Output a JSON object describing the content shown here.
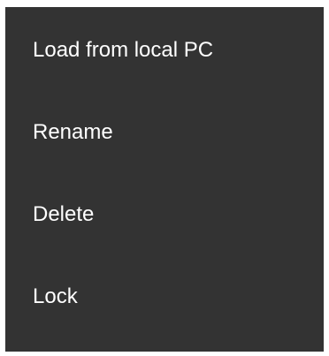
{
  "context_menu": {
    "items": [
      {
        "label": "Load from local PC"
      },
      {
        "label": "Rename"
      },
      {
        "label": "Delete"
      },
      {
        "label": "Lock"
      }
    ]
  },
  "colors": {
    "menu_background": "#333333",
    "menu_text": "#ffffff",
    "page_background": "#ffffff"
  }
}
